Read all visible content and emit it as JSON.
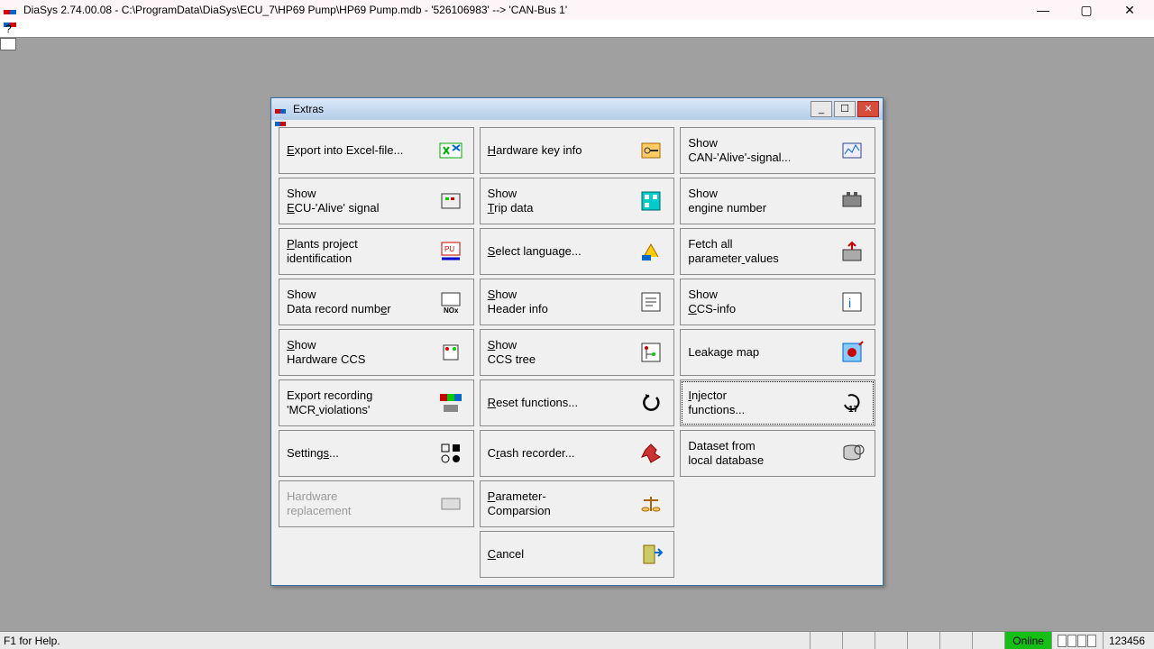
{
  "window": {
    "title": "DiaSys 2.74.00.08 - C:\\ProgramData\\DiaSys\\ECU_7\\HP69 Pump\\HP69 Pump.mdb - '526106983' --> 'CAN-Bus 1'"
  },
  "menubar": {
    "help": "?"
  },
  "dialog": {
    "title": "Extras",
    "col1": [
      {
        "label": "Export into Excel-file...",
        "u": 0,
        "icon": "excel"
      },
      {
        "label": "Show\nECU-'Alive' signal",
        "u": 5,
        "icon": "ecu"
      },
      {
        "label": "Plants project\nidentification",
        "u": 0,
        "icon": "plant"
      },
      {
        "label": "Show\nData record number",
        "u": 21,
        "icon": "nox"
      },
      {
        "label": "Show\nHardware CCS",
        "u": 0,
        "icon": "hwccs"
      },
      {
        "label": "Export recording\n'MCR violations'",
        "u": 21,
        "icon": "mcr"
      },
      {
        "label": "Settings...",
        "u": 7,
        "icon": "settings"
      },
      {
        "label": "Hardware\nreplacement",
        "u": -1,
        "icon": "hwrep",
        "disabled": true
      }
    ],
    "col2": [
      {
        "label": "Hardware key info",
        "u": 0,
        "icon": "key"
      },
      {
        "label": "Show\nTrip data",
        "u": 5,
        "icon": "trip"
      },
      {
        "label": "Select language...",
        "u": 0,
        "icon": "lang"
      },
      {
        "label": "Show\nHeader info",
        "u": 0,
        "icon": "header"
      },
      {
        "label": "Show\nCCS tree",
        "u": 0,
        "icon": "tree"
      },
      {
        "label": "Reset functions...",
        "u": 0,
        "icon": "reset"
      },
      {
        "label": "Crash recorder...",
        "u": 1,
        "icon": "crash"
      },
      {
        "label": "Parameter-\nComparsion",
        "u": 0,
        "icon": "compare"
      },
      {
        "label": "Cancel",
        "u": 0,
        "icon": "cancel"
      }
    ],
    "col3": [
      {
        "label": "Show\nCAN-'Alive'-signal...",
        "u": -1,
        "icon": "can"
      },
      {
        "label": "Show\nengine number",
        "u": -1,
        "icon": "engine"
      },
      {
        "label": "Fetch all\nparameter values",
        "u": 19,
        "icon": "fetch"
      },
      {
        "label": "Show\nCCS-info",
        "u": 5,
        "icon": "ccsinfo"
      },
      {
        "label": "Leakage map",
        "u": -1,
        "icon": "leak"
      },
      {
        "label": "Injector\nfunctions...",
        "u": 0,
        "icon": "injector",
        "focused": true
      },
      {
        "label": "Dataset from\nlocal database",
        "u": -1,
        "icon": "dataset"
      }
    ]
  },
  "status": {
    "msg": "F1 for Help.",
    "online": "Online",
    "counter": "123456"
  }
}
